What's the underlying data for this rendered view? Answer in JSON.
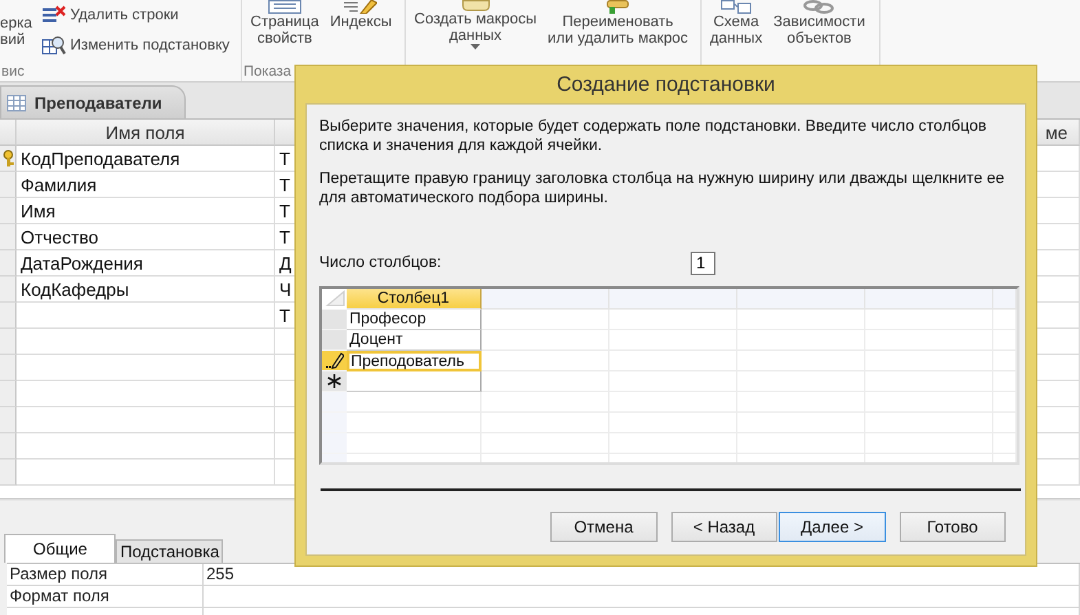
{
  "ribbon": {
    "groups": [
      {
        "label": "вис",
        "buttons": [
          {
            "kind": "cut",
            "label": "ерка\nвий"
          },
          {
            "kind": "small",
            "label": "Удалить строки"
          },
          {
            "kind": "small",
            "label": "Изменить подстановку"
          }
        ]
      },
      {
        "label": "Показа",
        "buttons": [
          {
            "kind": "large",
            "label": "Страница\nсвойств"
          },
          {
            "kind": "large",
            "label": "Индексы"
          }
        ]
      },
      {
        "buttons": [
          {
            "kind": "large",
            "label": "Создать макросы\nданных",
            "dropdown": true
          },
          {
            "kind": "large",
            "label": "Переименовать\nили удалить макрос"
          }
        ]
      },
      {
        "buttons": [
          {
            "kind": "large",
            "label": "Схема\nданных"
          },
          {
            "kind": "large",
            "label": "Зависимости\nобъектов"
          }
        ]
      }
    ]
  },
  "document_tab": {
    "label": "Преподаватели"
  },
  "table": {
    "header_field_name": "Имя поля",
    "header_column_3": "ме",
    "rows": [
      {
        "name": "КодПреподавателя",
        "column_2": "Т",
        "key": true
      },
      {
        "name": "Фамилия",
        "column_2": "Т",
        "key": false
      },
      {
        "name": "Имя",
        "column_2": "Т",
        "key": false
      },
      {
        "name": "Отчество",
        "column_2": "Т",
        "key": false
      },
      {
        "name": "ДатаРождения",
        "column_2": "Д",
        "key": false
      },
      {
        "name": "КодКафедры",
        "column_2": "Ч",
        "key": false
      },
      {
        "name": "",
        "column_2": "Т",
        "key": false
      }
    ]
  },
  "properties": {
    "tabs": [
      {
        "label": "Общие",
        "selected": true
      },
      {
        "label": "Подстановка",
        "selected": false
      }
    ],
    "rows": [
      {
        "label": "Размер поля",
        "value": "255"
      },
      {
        "label": "Формат поля",
        "value": ""
      }
    ]
  },
  "dialog": {
    "title": "Создание подстановки",
    "instructions": [
      "Выберите значения, которые будет содержать поле подстановки. Введите число столбцов списка и значения для каждой ячейки.",
      "Перетащите правую границу заголовка столбца на нужную ширину или дважды щелкните ее для автоматического подбора ширины."
    ],
    "column_count_label": "Число столбцов:",
    "column_count": "1",
    "grid": {
      "column_header": "Столбец1",
      "rows": [
        {
          "value": "Професор",
          "editing": false
        },
        {
          "value": "Доцент",
          "editing": false
        },
        {
          "value": "Преподователь",
          "editing": true
        }
      ]
    },
    "buttons": [
      {
        "label": "Отмена",
        "focused": false
      },
      {
        "label": "< Назад",
        "focused": false
      },
      {
        "label": "Далее >",
        "focused": true
      },
      {
        "label": "Готово",
        "focused": false
      }
    ]
  }
}
